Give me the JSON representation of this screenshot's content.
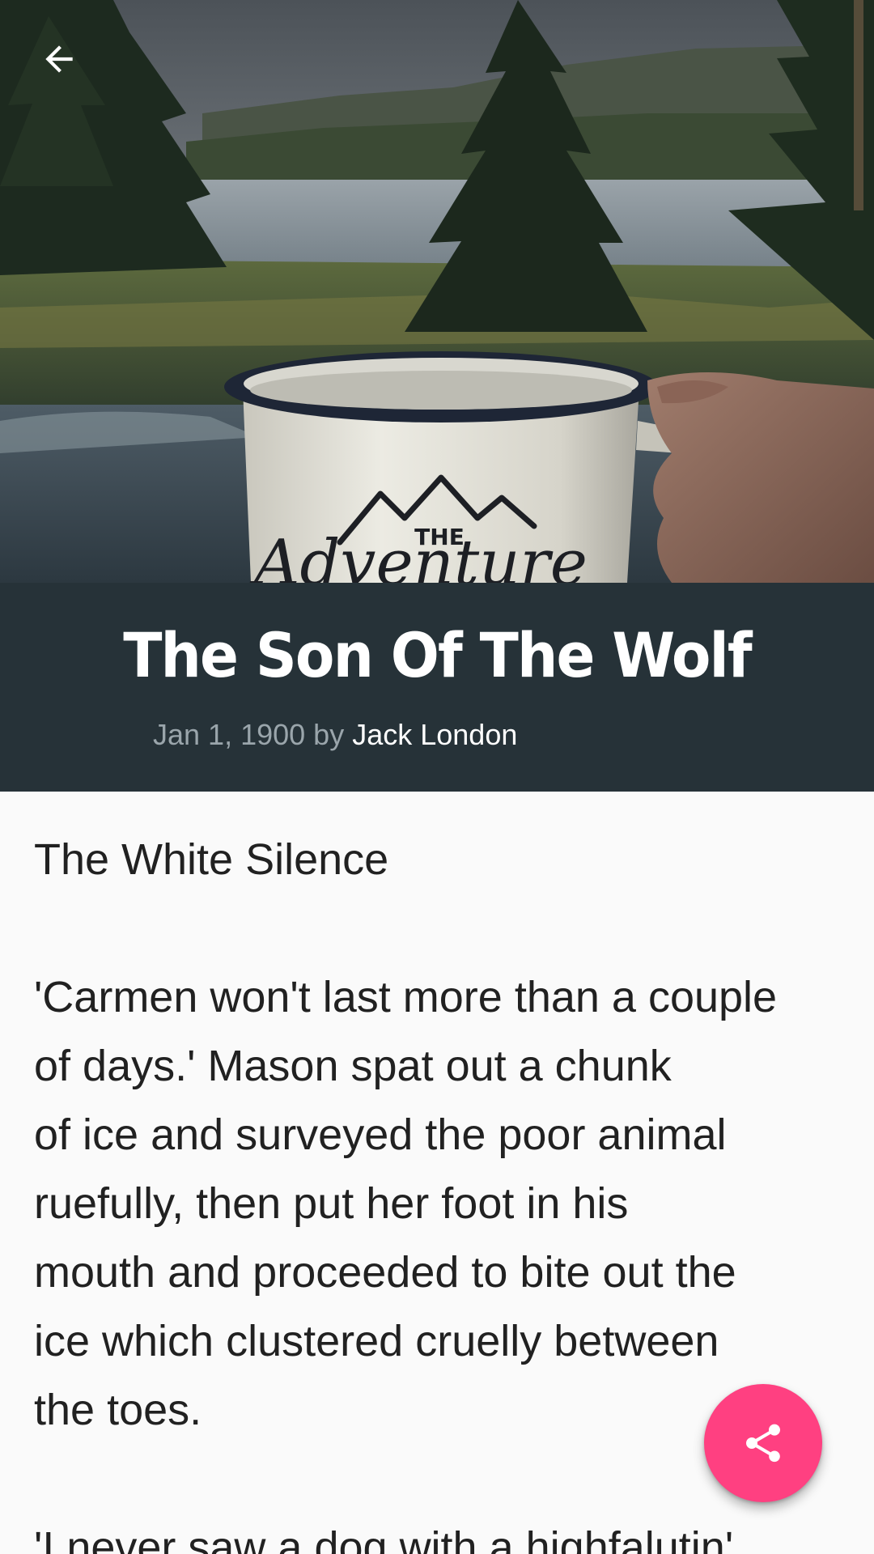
{
  "header": {
    "back_icon": "arrow-left-icon",
    "hero_image": "enamel mug labeled THE Adventure held in front of a forest lake",
    "mug_label_top": "THE",
    "mug_label_script": "Adventure"
  },
  "article": {
    "title": "The Son Of The Wolf",
    "date": "Jan 1, 1900",
    "by": "by",
    "author": "Jack London",
    "chapter_title": "The White Silence",
    "paragraphs": [
      "'Carmen won't last more than a couple\nof days.' Mason spat out a chunk\nof ice and surveyed the poor animal\nruefully, then put her foot in his\nmouth and proceeded to bite out the\nice which clustered cruelly between\nthe toes.",
      "'I never saw a dog with a highfalutin'"
    ]
  },
  "fab": {
    "icon": "share-icon",
    "color": "#ff4081"
  },
  "colors": {
    "title_band": "#263238",
    "background": "#fafafa",
    "accent": "#ff4081"
  }
}
